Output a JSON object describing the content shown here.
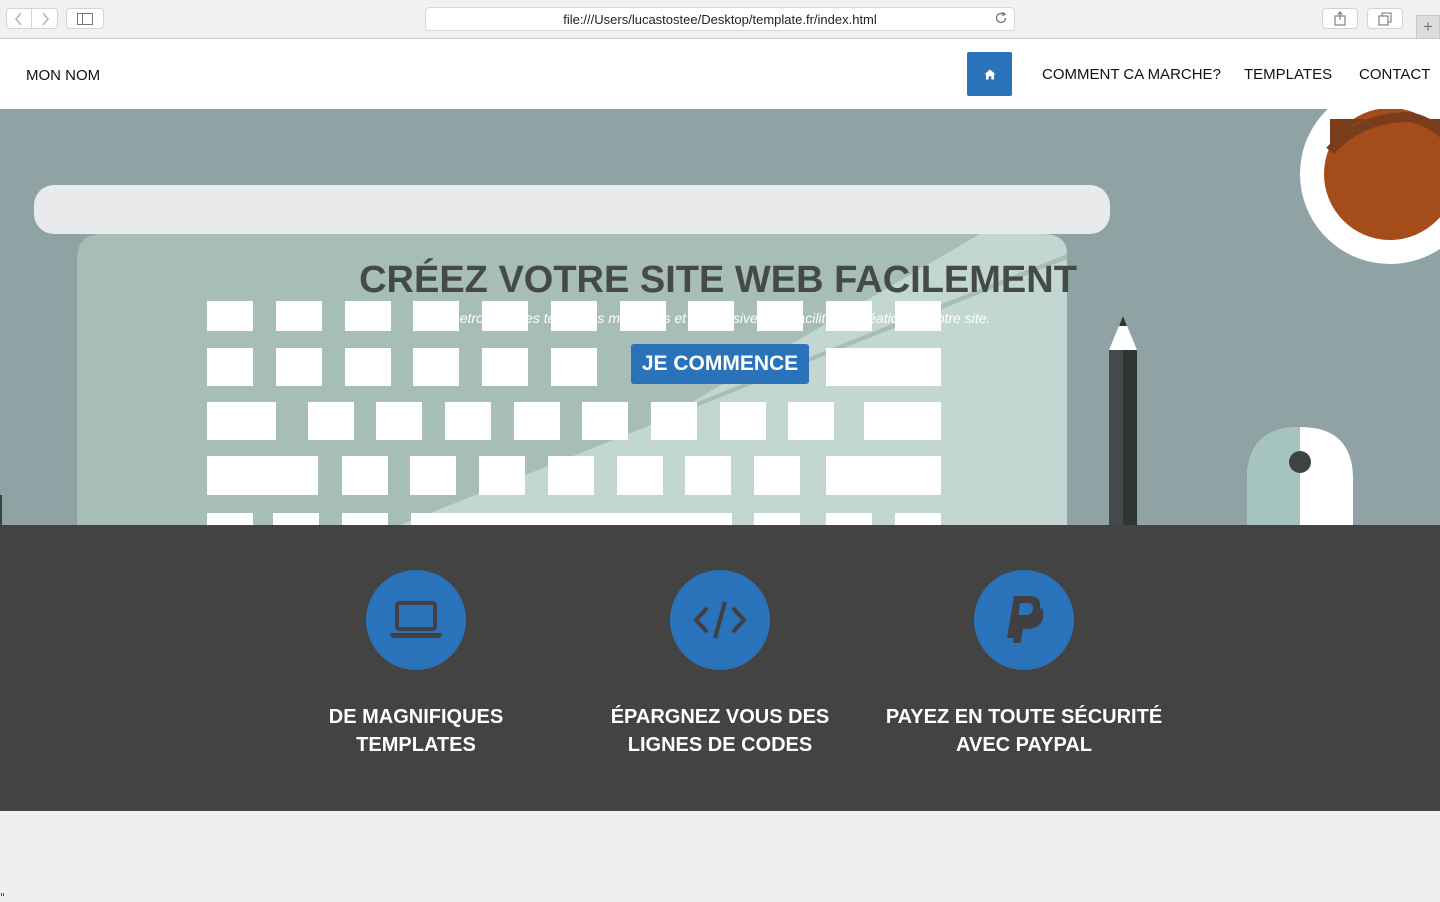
{
  "browser": {
    "url": "file:///Users/lucastostee/Desktop/template.fr/index.html",
    "new_tab_label": "+"
  },
  "header": {
    "brand": "MON NOM",
    "menu": [
      {
        "label": "COMMENT CA MARCHE?"
      },
      {
        "label": "TEMPLATES"
      },
      {
        "label": "CONTACT"
      }
    ]
  },
  "hero": {
    "title": "CRÉEZ VOTRE SITE WEB FACILEMENT",
    "subtitle": "Retrouvez des templates modernes et responsive pour faciliter la création de votre site.",
    "cta_label": "JE COMMENCE"
  },
  "features": [
    {
      "icon": "laptop-icon",
      "title_line1": "DE MAGNIFIQUES",
      "title_line2": "TEMPLATES"
    },
    {
      "icon": "code-icon",
      "title_line1": "ÉPARGNEZ VOUS DES",
      "title_line2": "LIGNES DE CODES"
    },
    {
      "icon": "paypal-icon",
      "title_line1": "PAYEZ EN TOUTE SÉCURITÉ",
      "title_line2": "AVEC PAYPAL"
    }
  ],
  "colors": {
    "primary_blue": "#2a72ba",
    "hero_bg": "#8fa3a5",
    "features_bg": "#434343",
    "title_color": "#454b44"
  }
}
